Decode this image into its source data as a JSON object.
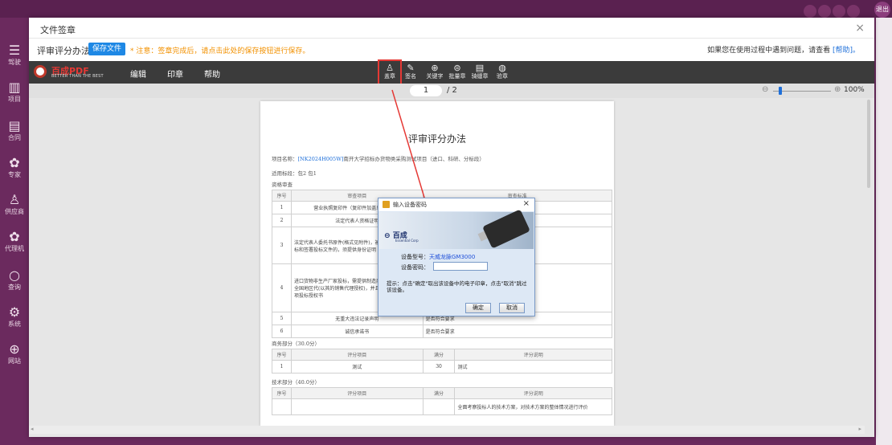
{
  "background_app": {
    "logout": "退出",
    "sidebar": [
      {
        "icon": "menu-icon",
        "label": "驾驶"
      },
      {
        "icon": "project-icon",
        "label": "项目"
      },
      {
        "icon": "contract-icon",
        "label": "合同"
      },
      {
        "icon": "expert-icon",
        "label": "专家"
      },
      {
        "icon": "supplier-icon",
        "label": "供应商"
      },
      {
        "icon": "agent-icon",
        "label": "代理机"
      },
      {
        "icon": "search-icon",
        "label": "查询"
      },
      {
        "icon": "system-icon",
        "label": "系统"
      },
      {
        "icon": "globe-icon",
        "label": "网站"
      }
    ]
  },
  "modal": {
    "title": "文件签章",
    "close": "×",
    "file_name": "评审评分办法.pdf",
    "save_button": "保存文件",
    "notice": "* 注意：签章完成后，请点击此处的保存按钮进行保存。",
    "help_prefix": "如果您在使用过程中遇到问题，请查看",
    "help_link": "[帮助]。"
  },
  "viewer": {
    "logo_name": "百成PDF",
    "logo_sub": "BETTER THAN THE BEST",
    "menu": [
      "编辑",
      "印章",
      "帮助"
    ],
    "tools": [
      {
        "icon": "stamp-icon",
        "label": "盖章"
      },
      {
        "icon": "sign-icon",
        "label": "签名"
      },
      {
        "icon": "keyword-icon",
        "label": "关键字"
      },
      {
        "icon": "batch-icon",
        "label": "批量章"
      },
      {
        "icon": "seam-icon",
        "label": "骑缝章"
      },
      {
        "icon": "verify-icon",
        "label": "验章"
      }
    ],
    "page_current": "1",
    "page_total": "/ 2",
    "zoom_minus": "⊖",
    "zoom_plus": "⊕",
    "zoom_level": "100%",
    "zoom_fraction": 0.12
  },
  "document": {
    "title": "评审评分办法",
    "project_line_prefix": "项目名称：",
    "project_code": "[NK2024H005W]",
    "project_line_suffix": "南开大学招标办货物类采购测试项目（进口、科研、分标段）",
    "applicable": "适用标段：包2 包1",
    "section1": "资格审查",
    "section1_header": [
      "序号",
      "审查项目",
      "审查标准"
    ],
    "section1_rows": [
      [
        "1",
        "营业执照复印件（复印件加盖单位公章）",
        "是否符合要求"
      ],
      [
        "2",
        "法定代表人资格证明",
        ""
      ],
      [
        "3",
        "法定代表人委托书原件(格式见附件)，被授权人本人参加投标和签署投标文件的，须提供身份证明 是否符合要求。",
        ""
      ],
      [
        "4",
        "进口货物非生产厂家投标，需提供制造商授权书或国总代、全国地区代(以其的销售代理授权)，并且是否符合要求的专项投标授权书",
        ""
      ],
      [
        "5",
        "无重大违法记录声明",
        "是否符合要求"
      ],
      [
        "6",
        "诚信承诺书",
        "是否符合要求"
      ]
    ],
    "section2": "商务部分（30.0分）",
    "section2_header": [
      "序号",
      "评分项目",
      "满分",
      "评分说明"
    ],
    "section2_rows": [
      [
        "1",
        "测试",
        "30",
        "测试"
      ]
    ],
    "section3": "技术部分（40.0分）",
    "section3_header": [
      "序号",
      "评分项目",
      "满分",
      "评分说明"
    ],
    "section3_rows": [
      [
        "",
        "",
        "",
        "全面考察投标人的技术方案，对技术方案的整体情况进行评价"
      ]
    ]
  },
  "dialog": {
    "title": "输入设备密码",
    "close": "×",
    "brand": "百成",
    "brand_sub": "Essential Corp",
    "device_type_label": "设备型号：",
    "device_type_value": "天威龙脉GM3000",
    "password_label": "设备密码：",
    "password_value": "",
    "tip": "提示：点击\"确定\"取出该设备中的电子印章，点击\"取消\"跳过该设备。",
    "ok": "确定",
    "cancel": "取消"
  },
  "colors": {
    "purple_bg": "#6b2a5e",
    "toolbar": "#3b3b3b",
    "accent_blue": "#1e88e5",
    "notice_orange": "#f29100",
    "highlight_red": "#e53935"
  }
}
